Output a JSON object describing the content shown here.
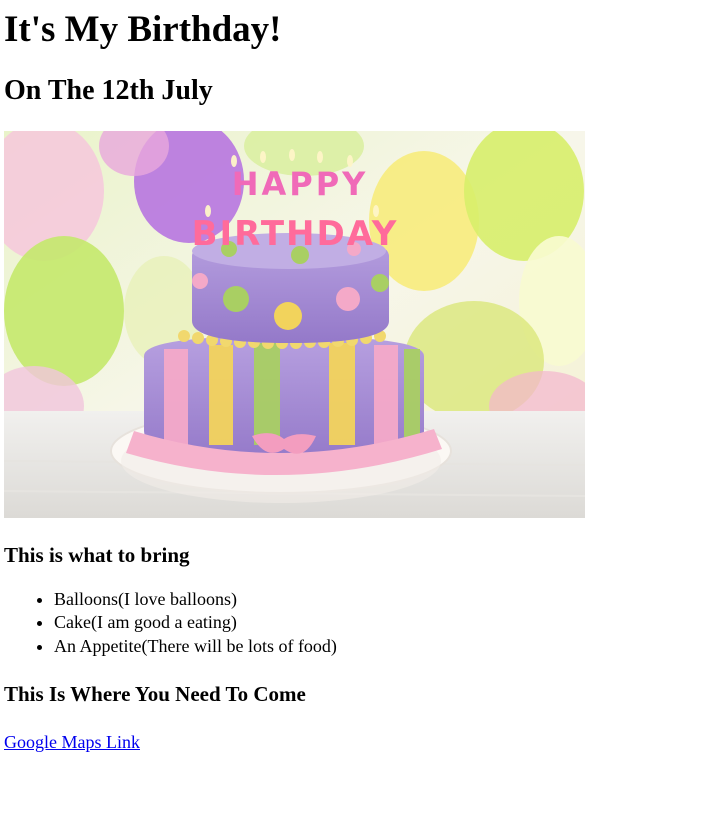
{
  "page": {
    "title": "It's My Birthday!",
    "subtitle": "On The 12th July"
  },
  "hero_image": {
    "cake_text_top": "HAPPY",
    "cake_text_bottom": "BIRTHDAY",
    "colors": {
      "cake_purple": "#a98fd6",
      "cake_pink": "#f4a9c8",
      "cake_yellow": "#f2d35c",
      "cake_green": "#a9cf63",
      "plate": "#f5f0ec"
    }
  },
  "bring": {
    "heading": "This is what to bring",
    "items": [
      "Balloons(I love balloons)",
      "Cake(I am good a eating)",
      "An Appetite(There will be lots of food)"
    ]
  },
  "location": {
    "heading": "This Is Where You Need To Come",
    "link_text": "Google Maps Link"
  }
}
